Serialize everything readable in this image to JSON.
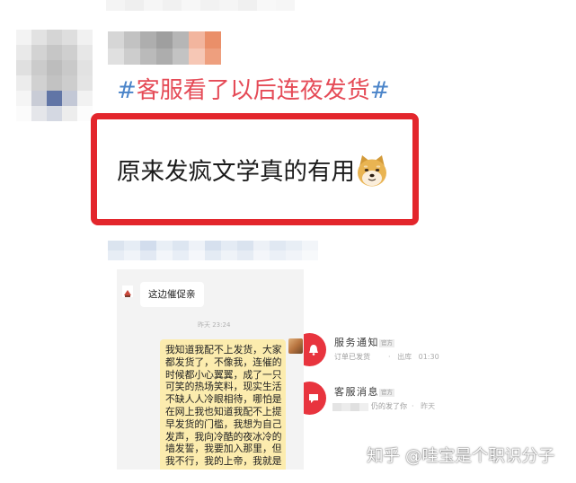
{
  "top_blur": {
    "mosaic": [
      [
        "#f4f4f4",
        "#efefef",
        "#f6f6f6",
        "#f1f1f1",
        "#f7f7f7",
        "#f2f2f2",
        "#f5f5f5",
        "#f0f0f0",
        "#f8f8f8",
        "#f6f6f6"
      ]
    ]
  },
  "avatar": {
    "mosaic": [
      [
        "#f3f3f3",
        "#e2e2e2",
        "#d5d5d5",
        "#dedede",
        "#f1f1f1"
      ],
      [
        "#e9e9e9",
        "#d3d3d3",
        "#c6c6c6",
        "#cfcfcf",
        "#e7e7e7"
      ],
      [
        "#e0e0e0",
        "#cbcbcb",
        "#bdbdbd",
        "#c9c9c9",
        "#e2e2e2"
      ],
      [
        "#ececec",
        "#d1d1d1",
        "#c2c2c2",
        "#cdcdcd",
        "#e4e4e4"
      ],
      [
        "#f5f5f5",
        "#c9ccd6",
        "#6175a6",
        "#c3c8d6",
        "#f2f2f2"
      ],
      [
        "#fbfbfb",
        "#e5e6ea",
        "#d4d8e2",
        "#ededed",
        "#fcfcfc"
      ]
    ]
  },
  "username": {
    "mosaic": [
      [
        "#d6d6d6",
        "#c2c2c2",
        "#aeaeae",
        "#9f9f9f",
        "#b6b6b6",
        "#f2b59e",
        "#ea8f69"
      ],
      [
        "#e0e0e0",
        "#cdcdcd",
        "#bababa",
        "#adadad",
        "#c3c3c3",
        "#f6c7b5",
        "#ee9f7e"
      ]
    ]
  },
  "post": {
    "hashtag": {
      "open": "#",
      "text": "客服看了以后连夜发货",
      "close": "#",
      "hash_color": "#4a84c9",
      "text_color": "#e54b57"
    },
    "highlight": {
      "text": "原来发疯文学真的有用",
      "border_color": "#e3262c",
      "emoji": "doge-icon"
    },
    "caption_blur": {
      "mosaic": [
        [
          "#dbe4ef",
          "#e6edf5",
          "#d2dded",
          "#e9eff6",
          "#dde6f1",
          "#eef2f8",
          "#d6e0ee",
          "#e4ebf4",
          "#dae3ef",
          "#edf1f7",
          "#e0e8f2",
          "#e8eef5",
          "#f2f5f9"
        ],
        [
          "#e7edf5",
          "#f0f4f9",
          "#e2e9f3",
          "#f3f6fa",
          "#e8eef6",
          "#f5f7fb",
          "#e4ebf4",
          "#eff3f8",
          "#e6ecf4",
          "#f4f6fa",
          "#ebf0f7",
          "#f1f4f9",
          "#f7f9fb"
        ]
      ]
    }
  },
  "screenshot": {
    "chat": {
      "incoming_message": "这边催促亲",
      "timestamp": "昨天 23:24",
      "bubble_color": "#fcecae",
      "outgoing_lines": [
        "我知道我配不上发货，大家",
        "都发货了，不像我，连催的",
        "时候都小心翼翼，成了一只",
        "可笑的热场笑料，现实生活",
        "不缺人人冷眼相待，哪怕是",
        "在网上我也知道我配不上提",
        "早发货的门槛，我想为自己",
        "发声，我向冷酷的夜冰冷的",
        "墙发誓，我要加入那里，但",
        "我不行，我的上帝，我就是"
      ]
    },
    "notifications": [
      {
        "icon": "service-bell-icon",
        "icon_color": "#e8343e",
        "title": "服务通知",
        "badge": "官方",
        "subtitle": "订单已发货",
        "meta": "· 出库 01:30"
      },
      {
        "icon": "chat-bubble-icon",
        "icon_color": "#e8343e",
        "title": "客服消息",
        "badge": "官方",
        "subtitle": "仍的发了你",
        "meta": "· 昨天",
        "blur_mosaic": [
          [
            "#e4e4e4",
            "#ececec",
            "#e0e0e0",
            "#efefef"
          ]
        ]
      }
    ]
  },
  "watermark": "知乎 @哇宝是个职识分子"
}
